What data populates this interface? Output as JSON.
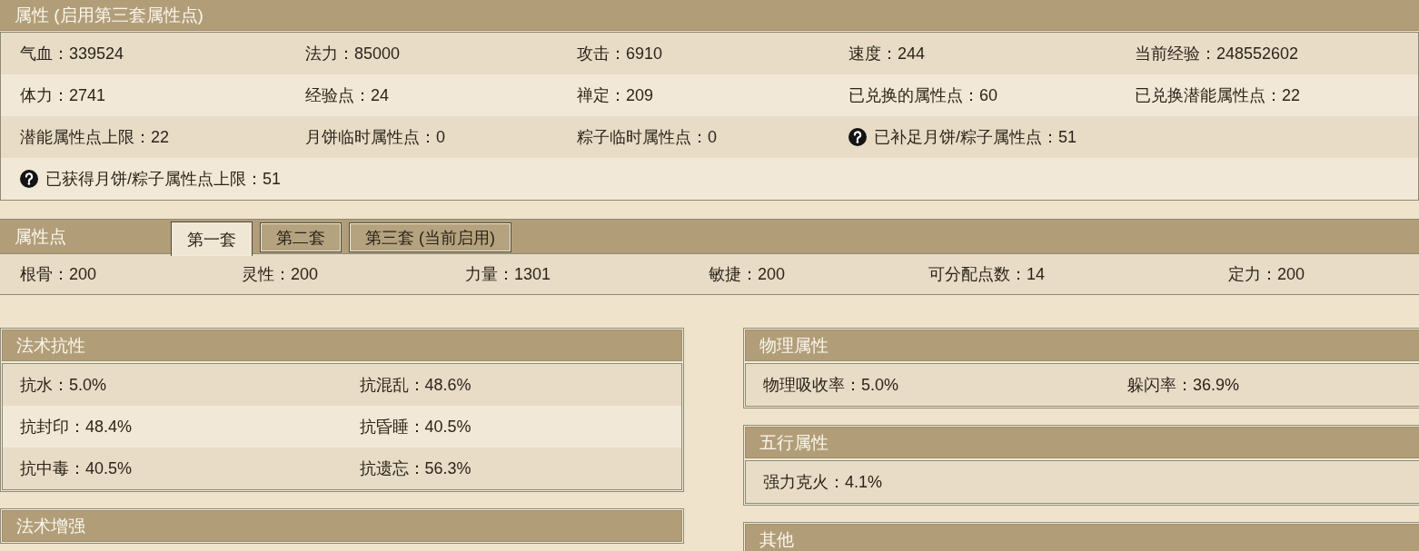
{
  "attributes": {
    "title": "属性 (启用第三套属性点)",
    "rows": [
      [
        {
          "kind": "stat",
          "text": "气血：339524"
        },
        {
          "kind": "stat",
          "text": "法力：85000"
        },
        {
          "kind": "stat",
          "text": "攻击：6910"
        },
        {
          "kind": "stat",
          "text": "速度：244"
        },
        {
          "kind": "stat",
          "text": "当前经验：248552602"
        }
      ],
      [
        {
          "kind": "stat",
          "text": "体力：2741"
        },
        {
          "kind": "stat",
          "text": "经验点：24"
        },
        {
          "kind": "stat",
          "text": "禅定：209"
        },
        {
          "kind": "stat",
          "text": "已兑换的属性点：60"
        },
        {
          "kind": "stat",
          "text": "已兑换潜能属性点：22"
        }
      ],
      [
        {
          "kind": "stat",
          "text": "潜能属性点上限：22"
        },
        {
          "kind": "stat",
          "text": "月饼临时属性点：0"
        },
        {
          "kind": "stat",
          "text": "粽子临时属性点：0"
        },
        {
          "kind": "help",
          "text": "已补足月饼/粽子属性点：51"
        }
      ],
      [
        {
          "kind": "help",
          "text": "已获得月饼/粽子属性点上限：51"
        }
      ]
    ]
  },
  "attribute_points": {
    "title": "属性点",
    "tabs": [
      {
        "label": "第一套",
        "selected": true
      },
      {
        "label": "第二套",
        "selected": false
      },
      {
        "label": "第三套 (当前启用)",
        "selected": false
      }
    ],
    "stats": [
      "根骨：200",
      "灵性：200",
      "力量：1301",
      "敏捷：200",
      "可分配点数：14",
      "定力：200"
    ]
  },
  "left_panels": [
    {
      "title": "法术抗性",
      "rows": [
        [
          "抗水：5.0%",
          "抗混乱：48.6%"
        ],
        [
          "抗封印：48.4%",
          "抗昏睡：40.5%"
        ],
        [
          "抗中毒：40.5%",
          "抗遗忘：56.3%"
        ]
      ]
    },
    {
      "title": "法术增强"
    }
  ],
  "right_panels": [
    {
      "title": "物理属性",
      "rows": [
        [
          "物理吸收率：5.0%",
          "躲闪率：36.9%"
        ]
      ]
    },
    {
      "title": "五行属性",
      "rows": [
        [
          "强力克火：4.1%"
        ]
      ]
    },
    {
      "title": "其他"
    }
  ]
}
